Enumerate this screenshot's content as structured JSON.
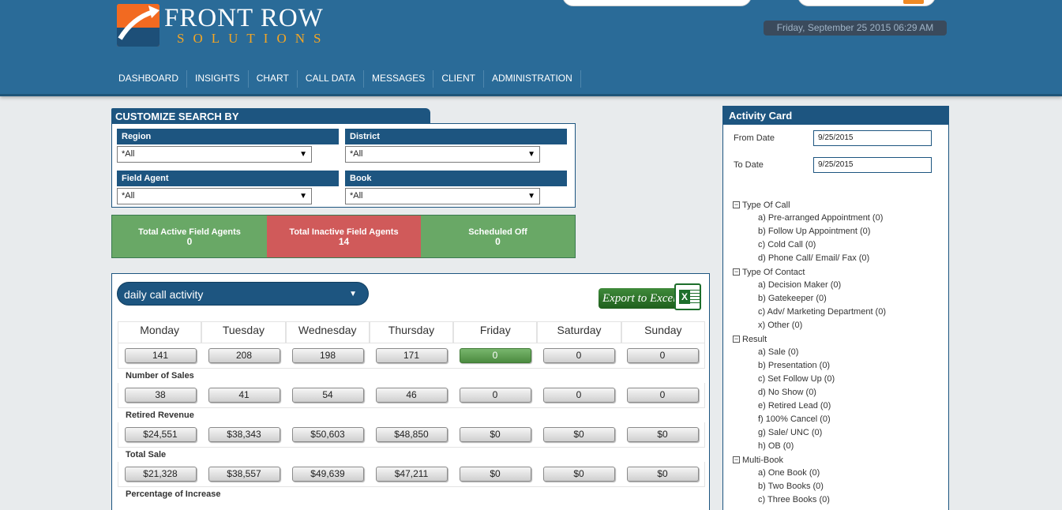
{
  "header": {
    "brand_name": "FRONT ROW",
    "brand_sub": "SOLUTIONS",
    "datetime": "Friday, September 25 2015 06:29 AM",
    "nav": [
      "DASHBOARD",
      "INSIGHTS",
      "CHART",
      "CALL DATA",
      "MESSAGES",
      "CLIENT",
      "ADMINISTRATION"
    ]
  },
  "search": {
    "title": "CUSTOMIZE SEARCH BY",
    "region_label": "Region",
    "region_value": "*All",
    "district_label": "District",
    "district_value": "*All",
    "agent_label": "Field Agent",
    "agent_value": "*All",
    "book_label": "Book",
    "book_value": "*All"
  },
  "status": [
    {
      "label": "Total Active Field Agents",
      "value": "0",
      "color": "#69a866"
    },
    {
      "label": "Total Inactive Field Agents",
      "value": "14",
      "color": "#d05a5a"
    },
    {
      "label": "Scheduled Off",
      "value": "0",
      "color": "#69a866"
    }
  ],
  "activity": {
    "dropdown_value": "daily call activity",
    "export_label": "Export to Excel",
    "days": [
      "Monday",
      "Tuesday",
      "Wednesday",
      "Thursday",
      "Friday",
      "Saturday",
      "Sunday"
    ],
    "row1": [
      "141",
      "208",
      "198",
      "171",
      "0",
      "0",
      "0"
    ],
    "sales_label": "Number of Sales",
    "row2": [
      "38",
      "41",
      "54",
      "46",
      "0",
      "0",
      "0"
    ],
    "retired_label": "Retired Revenue",
    "row3": [
      "$24,551",
      "$38,343",
      "$50,603",
      "$48,850",
      "$0",
      "$0",
      "$0"
    ],
    "total_label": "Total Sale",
    "row4": [
      "$21,328",
      "$38,557",
      "$49,639",
      "$47,211",
      "$0",
      "$0",
      "$0"
    ],
    "increase_label": "Percentage of Increase",
    "highlight_color": "#5e9e52"
  },
  "card": {
    "title": "Activity Card",
    "from_label": "From Date",
    "from_value": "9/25/2015",
    "to_label": "To Date",
    "to_value": "9/25/2015",
    "tree": [
      {
        "group": "Type Of Call",
        "items": [
          "a) Pre-arranged Appointment (0)",
          "b) Follow Up Appointment (0)",
          "c) Cold Call (0)",
          "d) Phone Call/ Email/ Fax (0)"
        ]
      },
      {
        "group": "Type Of Contact",
        "items": [
          "a) Decision Maker (0)",
          "b) Gatekeeper (0)",
          "c) Adv/ Marketing Department (0)",
          "x) Other (0)"
        ]
      },
      {
        "group": "Result",
        "items": [
          "a) Sale (0)",
          "b) Presentation (0)",
          "c) Set Follow Up (0)",
          "d) No Show (0)",
          "e) Retired Lead (0)",
          "f) 100% Cancel (0)",
          "g) Sale/ UNC (0)",
          "h) OB (0)"
        ]
      },
      {
        "group": "Multi-Book",
        "items": [
          "a) One Book (0)",
          "b) Two Books (0)",
          "c) Three Books (0)"
        ]
      }
    ]
  }
}
